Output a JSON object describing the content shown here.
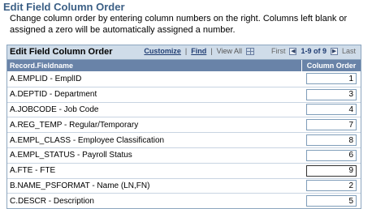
{
  "page_title": "Edit Field Column Order",
  "instructions": "Change column order by entering column numbers on the right. Columns left blank or assigned a zero will be automatically assigned a number.",
  "grid": {
    "title": "Edit Field Column Order",
    "nav": {
      "customize": "Customize",
      "find": "Find",
      "view_all": "View All",
      "first": "First",
      "range": "1-9 of 9",
      "last": "Last"
    },
    "columns": {
      "fieldname": "Record.Fieldname",
      "order": "Column Order"
    },
    "rows": [
      {
        "field": "A.EMPLID - EmplID",
        "order": "1"
      },
      {
        "field": "A.DEPTID - Department",
        "order": "3"
      },
      {
        "field": "A.JOBCODE - Job Code",
        "order": "4"
      },
      {
        "field": "A.REG_TEMP - Regular/Temporary",
        "order": "7"
      },
      {
        "field": "A.EMPL_CLASS - Employee Classification",
        "order": "8"
      },
      {
        "field": "A.EMPL_STATUS - Payroll Status",
        "order": "6"
      },
      {
        "field": "A.FTE - FTE",
        "order": "9"
      },
      {
        "field": "B.NAME_PSFORMAT - Name (LN,FN)",
        "order": "2"
      },
      {
        "field": "C.DESCR - Description",
        "order": "5"
      }
    ]
  },
  "icons": {
    "grid_view": "grid-icon",
    "prev": "prev-arrow-icon",
    "next": "next-arrow-icon"
  }
}
